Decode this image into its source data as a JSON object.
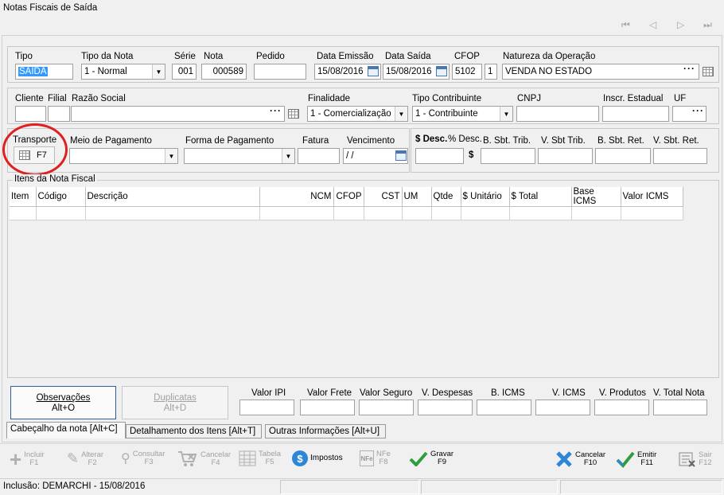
{
  "window": {
    "title": "Notas Fiscais de Saída"
  },
  "header": {
    "tipo_label": "Tipo",
    "tipo_value": "SAIDA",
    "tipo_nota_label": "Tipo da Nota",
    "tipo_nota_value": "1 - Normal",
    "serie_label": "Série",
    "serie_value": "001",
    "nota_label": "Nota",
    "nota_value": "000589",
    "pedido_label": "Pedido",
    "pedido_value": "",
    "data_emissao_label": "Data Emissão",
    "data_emissao_value": "15/08/2016",
    "data_saida_label": "Data Saída",
    "data_saida_value": "15/08/2016",
    "cfop_label": "CFOP",
    "cfop_value": "5102",
    "cfop_seq": "1",
    "natureza_label": "Natureza da Operação",
    "natureza_value": "VENDA NO ESTADO"
  },
  "cliente": {
    "cliente_label": "Cliente",
    "filial_label": "Filial",
    "razao_label": "Razão Social",
    "finalidade_label": "Finalidade",
    "finalidade_value": "1 - Comercialização",
    "tipo_contrib_label": "Tipo Contribuinte",
    "tipo_contrib_value": "1 - Contribuinte",
    "cnpj_label": "CNPJ",
    "ie_label": "Inscr. Estadual",
    "uf_label": "UF"
  },
  "pagamento": {
    "transporte_label": "Transporte",
    "transporte_key": "F7",
    "meio_label": "Meio de Pagamento",
    "forma_label": "Forma de Pagamento",
    "fatura_label": "Fatura",
    "vencimento_label": "Vencimento",
    "vencimento_value": " / /",
    "desc_label": "$ Desc.",
    "pdesc_label": "% Desc.",
    "currency_symbol": "$",
    "bsbt_trib_label": "B. Sbt. Trib.",
    "vsbt_trib_label": "V. Sbt Trib.",
    "bsbt_ret_label": "B. Sbt. Ret.",
    "vsbt_ret_label": "V. Sbt. Ret."
  },
  "items": {
    "group_label": "Itens da Nota Fiscal",
    "columns": [
      "Item",
      "Código",
      "Descrição",
      "NCM",
      "CFOP",
      "CST",
      "UM",
      "Qtde",
      "$ Unitário",
      "$ Total",
      "Base ICMS",
      "Valor ICMS"
    ]
  },
  "footer": {
    "observacoes_label": "Observações",
    "observacoes_key": "Alt+O",
    "duplicatas_label": "Duplicatas",
    "duplicatas_key": "Alt+D",
    "totals_labels": [
      "Valor IPI",
      "Valor Frete",
      "Valor Seguro",
      "V. Despesas",
      "B. ICMS",
      "V. ICMS",
      "V. Produtos",
      "V. Total Nota"
    ]
  },
  "tabs": [
    {
      "label": "Cabeçalho da nota  [Alt+C]"
    },
    {
      "label": "Detalhamento dos Itens  [Alt+T]"
    },
    {
      "label": "Outras Informações  [Alt+U]"
    }
  ],
  "toolbar": {
    "incluir": "Incluir",
    "incluir_key": "F1",
    "alterar": "Alterar",
    "alterar_key": "F2",
    "consultar": "Consultar",
    "consultar_key": "F3",
    "cancelar_item": "Cancelar",
    "cancelar_item_key": "F4",
    "tabela": "Tabela",
    "tabela_key": "F5",
    "impostos": "Impostos",
    "nfe": "NFe",
    "nfe_key": "F8",
    "gravar": "Gravar",
    "gravar_key": "F9",
    "cancelar": "Cancelar",
    "cancelar_key": "F10",
    "emitir": "Emitir",
    "emitir_key": "F11",
    "sair": "Sair",
    "sair_key": "F12"
  },
  "status": {
    "text": "Inclusão: DEMARCHI - 15/08/2016"
  },
  "colors": {
    "highlight": "#3399ff",
    "annotation_red": "#e02020",
    "icon_green": "#2e9e3c",
    "icon_blue": "#2f86d6"
  }
}
